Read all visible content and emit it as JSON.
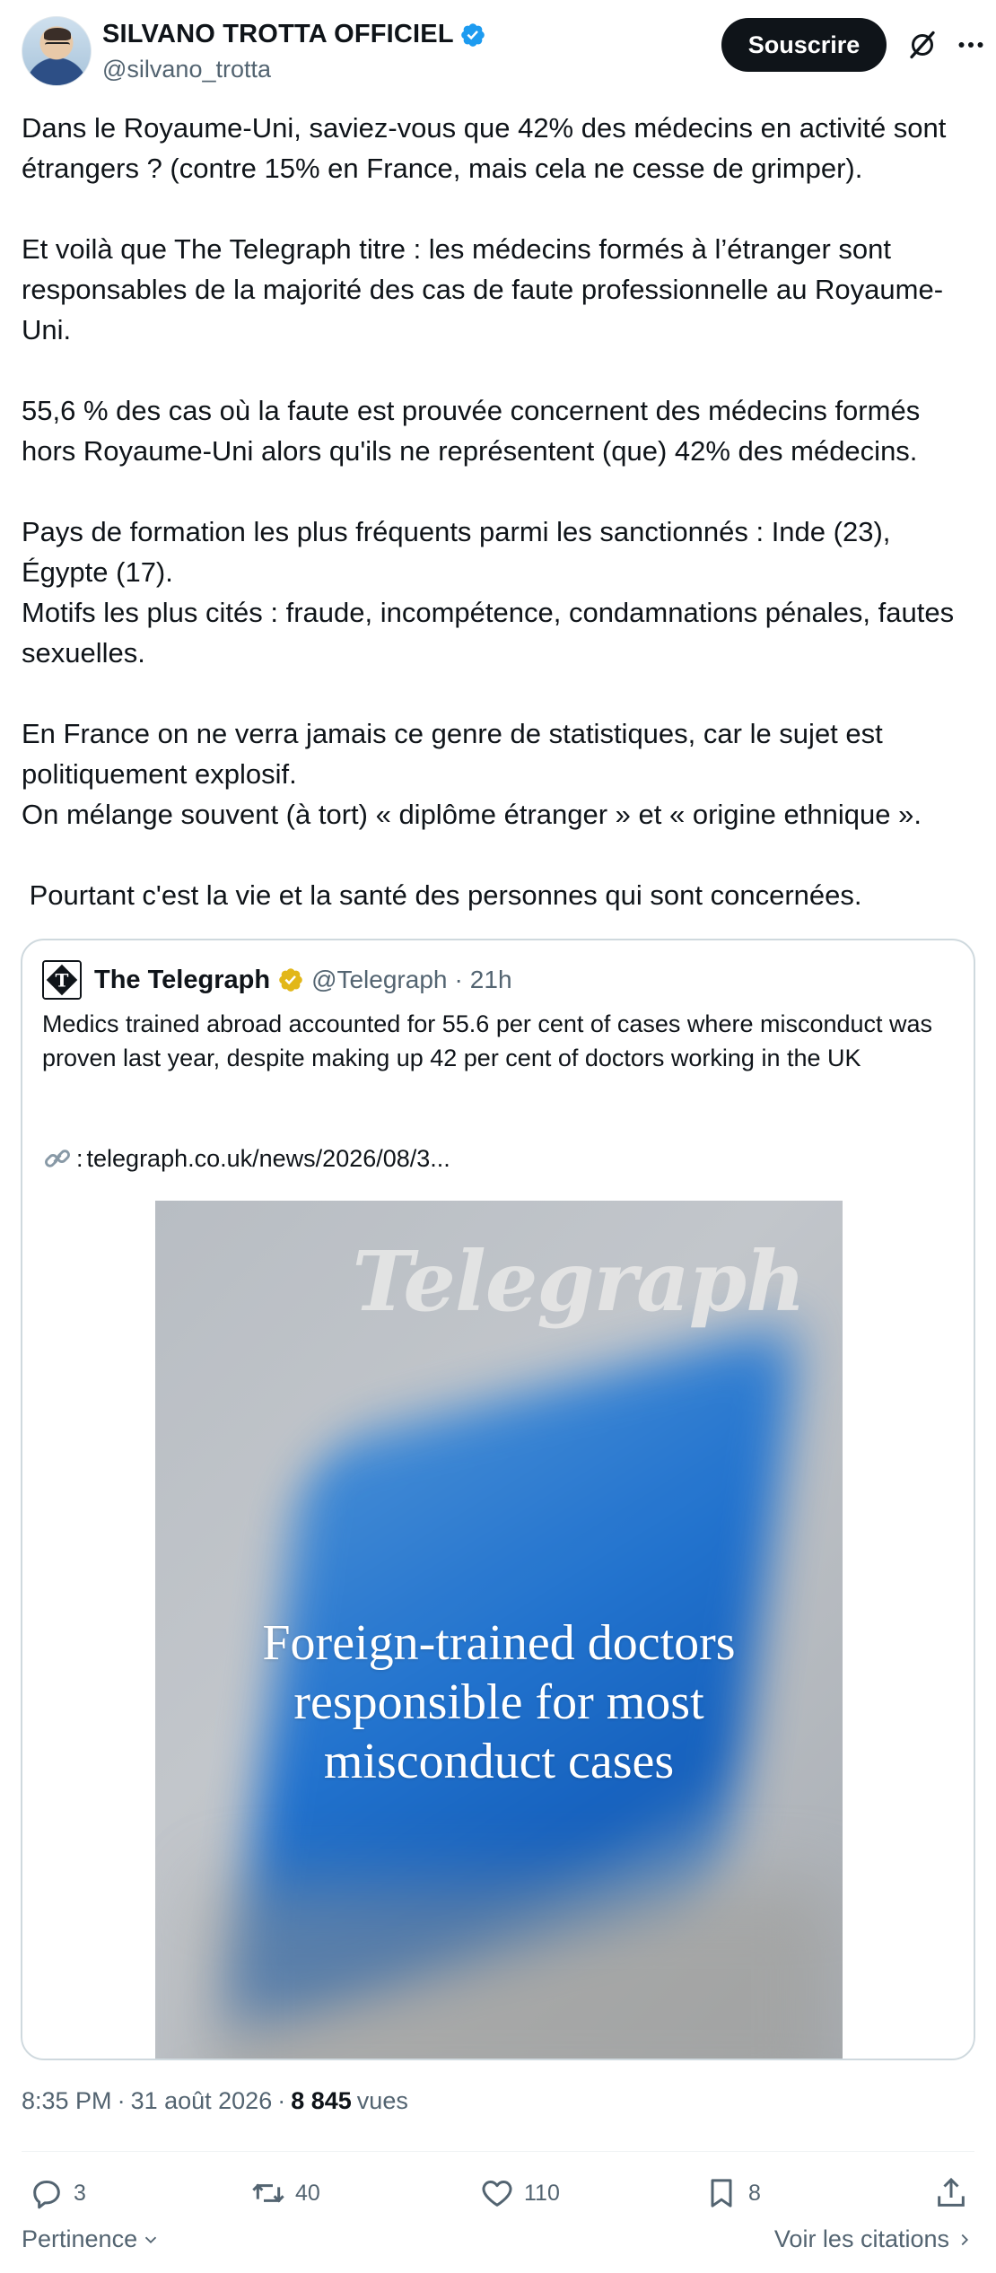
{
  "author": {
    "display_name": "SILVANO TROTTA OFFICIEL",
    "handle": "@silvano_trotta",
    "verified_color": "#1d9bf0"
  },
  "header": {
    "subscribe_label": "Souscrire",
    "grok_icon": "grok-icon",
    "more_icon": "more-icon"
  },
  "tweet": {
    "paragraphs": [
      "Dans le Royaume-Uni, saviez-vous que 42% des médecins en activité sont étrangers ? (contre 15% en France, mais cela ne cesse de grimper).",
      "Et voilà que The Telegraph titre : les médecins formés à l’étranger sont responsables de la majorité des cas de faute professionnelle au Royaume-Uni.",
      "55,6 % des cas où la faute est prouvée concernent des médecins formés hors Royaume-Uni alors qu'ils ne représentent (que) 42% des médecins.",
      "Pays de formation les plus fréquents parmi les sanctionnés : Inde (23), Égypte (17).\nMotifs les plus cités : fraude, incompétence, condamnations pénales, fautes sexuelles.",
      "En France on ne verra jamais ce genre de statistiques, car le sujet est politiquement explosif.\nOn mélange souvent (à tort) « diplôme étranger » et « origine ethnique ».",
      " Pourtant c'est la vie et la santé des personnes qui sont concernées."
    ]
  },
  "quote": {
    "name": "The Telegraph",
    "handle": "@Telegraph",
    "separator": "·",
    "time": "21h",
    "gold_color": "#e2b719",
    "text": "Medics trained abroad accounted for 55.6 per cent of cases where misconduct was proven last year, despite making up 42 per cent of doctors working in the UK",
    "link_prefix": ":",
    "link_text": "telegraph.co.uk/news/2026/08/3...",
    "media": {
      "wordmark": "Telegraph",
      "headline_lines": [
        "Foreign-trained doctors",
        "responsible for most",
        "misconduct cases"
      ]
    }
  },
  "meta": {
    "time": "8:35 PM",
    "sep1": "·",
    "date": "31 août 2026",
    "sep2": "·",
    "views_count": "8 845",
    "views_label": "vues"
  },
  "actions": {
    "replies": "3",
    "reposts": "40",
    "likes": "110",
    "bookmarks": "8"
  },
  "footer": {
    "sort_label": "Pertinence",
    "quotes_label": "Voir les citations"
  }
}
